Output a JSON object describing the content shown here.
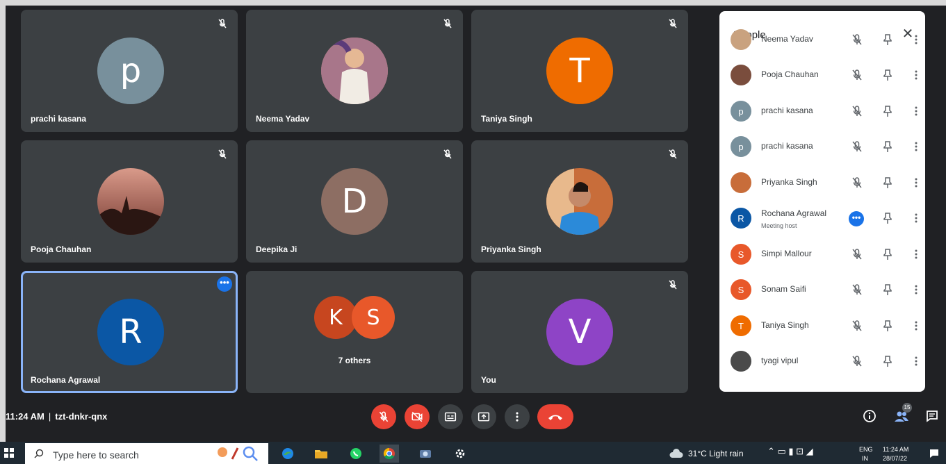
{
  "tiles": [
    {
      "name": "prachi kasana",
      "initial": "p",
      "color": "#78909c"
    },
    {
      "name": "Neema Yadav",
      "initial": "",
      "color": "#c9a27f"
    },
    {
      "name": "Taniya Singh",
      "initial": "T",
      "color": "#ef6c00"
    },
    {
      "name": "Pooja Chauhan",
      "initial": "",
      "color": "#7a4d3d"
    },
    {
      "name": "Deepika Ji",
      "initial": "D",
      "color": "#8d6e63"
    },
    {
      "name": "Priyanka Singh",
      "initial": "",
      "color": "#c86d3a"
    },
    {
      "name": "Rochana Agrawal",
      "initial": "R",
      "color": "#0b57a5"
    },
    {
      "name": "",
      "initial": "",
      "color": "#3c4043"
    },
    {
      "name": "You",
      "initial": "V",
      "color": "#8e44c6"
    }
  ],
  "others": {
    "label": "7 others",
    "avatars": [
      {
        "initial": "K",
        "color": "#c7461f"
      },
      {
        "initial": "S",
        "color": "#e8582a"
      }
    ]
  },
  "panel": {
    "title": "People",
    "close_icon": "close-icon",
    "people": [
      {
        "name": "Neema Yadav",
        "initial": "",
        "color": "#c9a27f",
        "sub": ""
      },
      {
        "name": "Pooja Chauhan",
        "initial": "",
        "color": "#7a4d3d",
        "sub": ""
      },
      {
        "name": "prachi kasana",
        "initial": "p",
        "color": "#78909c",
        "sub": ""
      },
      {
        "name": "prachi kasana",
        "initial": "p",
        "color": "#78909c",
        "sub": ""
      },
      {
        "name": "Priyanka Singh",
        "initial": "",
        "color": "#c86d3a",
        "sub": ""
      },
      {
        "name": "Rochana Agrawal",
        "initial": "R",
        "color": "#0b57a5",
        "sub": "Meeting host"
      },
      {
        "name": "Simpi Mallour",
        "initial": "S",
        "color": "#e8582a",
        "sub": ""
      },
      {
        "name": "Sonam Saifi",
        "initial": "S",
        "color": "#e8582a",
        "sub": ""
      },
      {
        "name": "Taniya Singh",
        "initial": "T",
        "color": "#ef6c00",
        "sub": ""
      },
      {
        "name": "tyagi vipul",
        "initial": "",
        "color": "#4a4a4a",
        "sub": ""
      }
    ]
  },
  "bottom_bar": {
    "time": "11:24 AM",
    "separator": "|",
    "meeting_code": "tzt-dnkr-qnx",
    "people_count": "15"
  },
  "taskbar": {
    "search_placeholder": "Type here to search",
    "weather": "31°C  Light rain",
    "lang": "ENG",
    "lang_sub": "IN",
    "clock_time": "11:24 AM",
    "clock_date": "28/07/22"
  },
  "colors": {
    "accent": "#1a73e8",
    "danger": "#ea4335",
    "tile_bg": "#3c4043",
    "meet_bg": "#202124"
  }
}
